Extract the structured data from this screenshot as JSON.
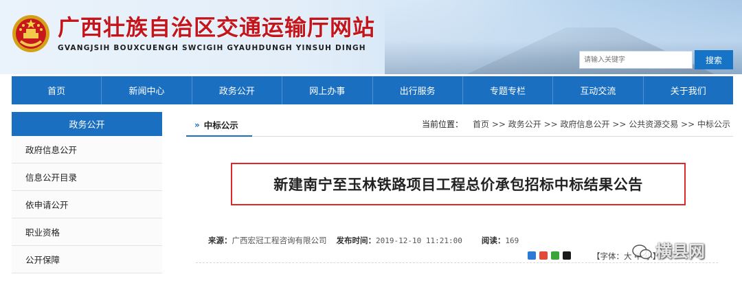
{
  "header": {
    "title": "广西壮族自治区交通运输厅网站",
    "subtitle": "GVANGJSIH BOUXCUENGH SWCIGIH GYAUHDUNGH YINSUH DINGH",
    "search_placeholder": "请输入关键字",
    "search_button": "搜索"
  },
  "nav": {
    "items": [
      "首页",
      "新闻中心",
      "政务公开",
      "网上办事",
      "出行服务",
      "专题专栏",
      "互动交流",
      "关于我们"
    ]
  },
  "sidebar": {
    "heading": "政务公开",
    "items": [
      "政府信息公开",
      "信息公开目录",
      "依申请公开",
      "职业资格",
      "公开保障"
    ]
  },
  "main": {
    "tab_label": "中标公示",
    "breadcrumb_label": "当前位置：",
    "breadcrumb_path": "首页 >> 政务公开 >> 政府信息公开 >> 公共资源交易 >> 中标公示",
    "notice_title": "新建南宁至玉林铁路项目工程总价承包招标中标结果公告",
    "source_label": "来源：",
    "source_value": "广西宏冠工程咨询有限公司",
    "time_label": "发布时间：",
    "time_value": "2019-12-10 11:21:00",
    "reads_label": "阅读：",
    "reads_value": "169",
    "font_label": "【字体：",
    "font_rest": "大 中 小】"
  },
  "watermark": {
    "text": "横县网"
  },
  "colors": {
    "brand_blue": "#1a6fc0",
    "title_red": "#c2151c",
    "highlight_border": "#e02626"
  }
}
